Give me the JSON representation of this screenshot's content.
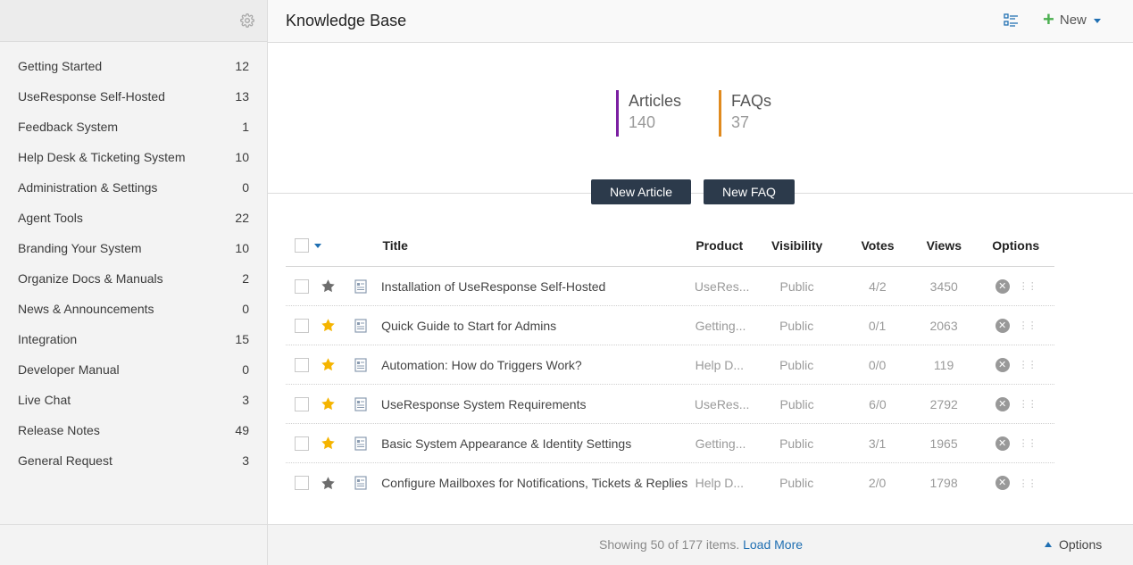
{
  "sidebar": {
    "settings_icon": "gear-icon",
    "categories": [
      {
        "label": "Getting Started",
        "count": "12"
      },
      {
        "label": "UseResponse Self-Hosted",
        "count": "13"
      },
      {
        "label": "Feedback System",
        "count": "1"
      },
      {
        "label": "Help Desk & Ticketing System",
        "count": "10"
      },
      {
        "label": "Administration & Settings",
        "count": "0"
      },
      {
        "label": "Agent Tools",
        "count": "22"
      },
      {
        "label": "Branding Your System",
        "count": "10"
      },
      {
        "label": "Organize Docs & Manuals",
        "count": "2"
      },
      {
        "label": "News & Announcements",
        "count": "0"
      },
      {
        "label": "Integration",
        "count": "15"
      },
      {
        "label": "Developer Manual",
        "count": "0"
      },
      {
        "label": "Live Chat",
        "count": "3"
      },
      {
        "label": "Release Notes",
        "count": "49"
      },
      {
        "label": "General Request",
        "count": "3"
      }
    ]
  },
  "header": {
    "title": "Knowledge Base",
    "new_label": "New"
  },
  "stats": {
    "articles_label": "Articles",
    "articles_value": "140",
    "articles_color": "#7b1fa2",
    "faqs_label": "FAQs",
    "faqs_value": "37",
    "faqs_color": "#e08a1e"
  },
  "actions": {
    "new_article": "New Article",
    "new_faq": "New FAQ"
  },
  "table": {
    "columns": {
      "title": "Title",
      "product": "Product",
      "visibility": "Visibility",
      "votes": "Votes",
      "views": "Views",
      "options": "Options"
    },
    "rows": [
      {
        "starred": false,
        "title": "Installation of UseResponse Self-Hosted",
        "product": "UseRes...",
        "visibility": "Public",
        "votes": "4/2",
        "views": "3450"
      },
      {
        "starred": true,
        "title": "Quick Guide to Start for Admins",
        "product": "Getting...",
        "visibility": "Public",
        "votes": "0/1",
        "views": "2063"
      },
      {
        "starred": true,
        "title": "Automation: How do Triggers Work?",
        "product": "Help D...",
        "visibility": "Public",
        "votes": "0/0",
        "views": "119"
      },
      {
        "starred": true,
        "title": "UseResponse System Requirements",
        "product": "UseRes...",
        "visibility": "Public",
        "votes": "6/0",
        "views": "2792"
      },
      {
        "starred": true,
        "title": "Basic System Appearance & Identity Settings",
        "product": "Getting...",
        "visibility": "Public",
        "votes": "3/1",
        "views": "1965"
      },
      {
        "starred": false,
        "title": "Configure Mailboxes for Notifications, Tickets & Replies",
        "product": "Help D...",
        "visibility": "Public",
        "votes": "2/0",
        "views": "1798"
      }
    ]
  },
  "footer": {
    "showing_text": "Showing 50 of 177 items.",
    "load_more": "Load More",
    "options_label": "Options"
  },
  "colors": {
    "accent_blue": "#1f6fb2",
    "dark_button": "#2c3a4b",
    "star_gold": "#f5b400",
    "star_gray": "#6d6d6d",
    "plus_green": "#4caf50"
  }
}
